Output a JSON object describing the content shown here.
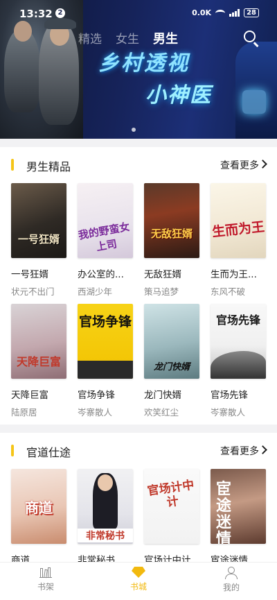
{
  "status_bar": {
    "time": "13:32",
    "notification_count": "2",
    "network_speed": "0.0K",
    "battery": "28"
  },
  "top_tabs": [
    {
      "label": "精选",
      "active": false
    },
    {
      "label": "女生",
      "active": false
    },
    {
      "label": "男生",
      "active": true
    }
  ],
  "banner": {
    "title": "乡村透视",
    "subtitle": "小神医"
  },
  "sections": [
    {
      "title": "男生精品",
      "more_label": "查看更多",
      "books": [
        {
          "name": "一号狂婿",
          "author": "状元不出门",
          "cover_text": "一号狂婿"
        },
        {
          "name": "办公室的...",
          "author": "西湖少年",
          "cover_text": "我的野蛮女上司"
        },
        {
          "name": "无敌狂婿",
          "author": "策马追梦",
          "cover_text": "无敌狂婿"
        },
        {
          "name": "生而为王...",
          "author": "东风不破",
          "cover_text": "生而为王"
        },
        {
          "name": "天降巨富",
          "author": "陆原居",
          "cover_text": "天降巨富"
        },
        {
          "name": "官场争锋",
          "author": "岑寨散人",
          "cover_text": "官场争锋"
        },
        {
          "name": "龙门快婿",
          "author": "欢笑红尘",
          "cover_text": "龙门快婿"
        },
        {
          "name": "官场先锋",
          "author": "岑寨散人",
          "cover_text": "官场先锋"
        }
      ]
    },
    {
      "title": "官道仕途",
      "more_label": "查看更多",
      "books": [
        {
          "name": "商道",
          "cover_text": "商道"
        },
        {
          "name": "非常秘书",
          "cover_text": "非常秘书"
        },
        {
          "name": "官场计中计",
          "cover_text": "官场计中计"
        },
        {
          "name": "宦途迷情",
          "cover_text": "宦途迷情"
        }
      ]
    }
  ],
  "bottom_nav": [
    {
      "label": "书架",
      "icon": "bookshelf-icon",
      "active": false
    },
    {
      "label": "书城",
      "icon": "bookstore-icon",
      "active": true
    },
    {
      "label": "我的",
      "icon": "profile-icon",
      "active": false
    }
  ],
  "colors": {
    "accent": "#f2b90f",
    "section_bar": "#f5c518",
    "banner_bg": "#16235a",
    "muted_text": "#888888"
  }
}
